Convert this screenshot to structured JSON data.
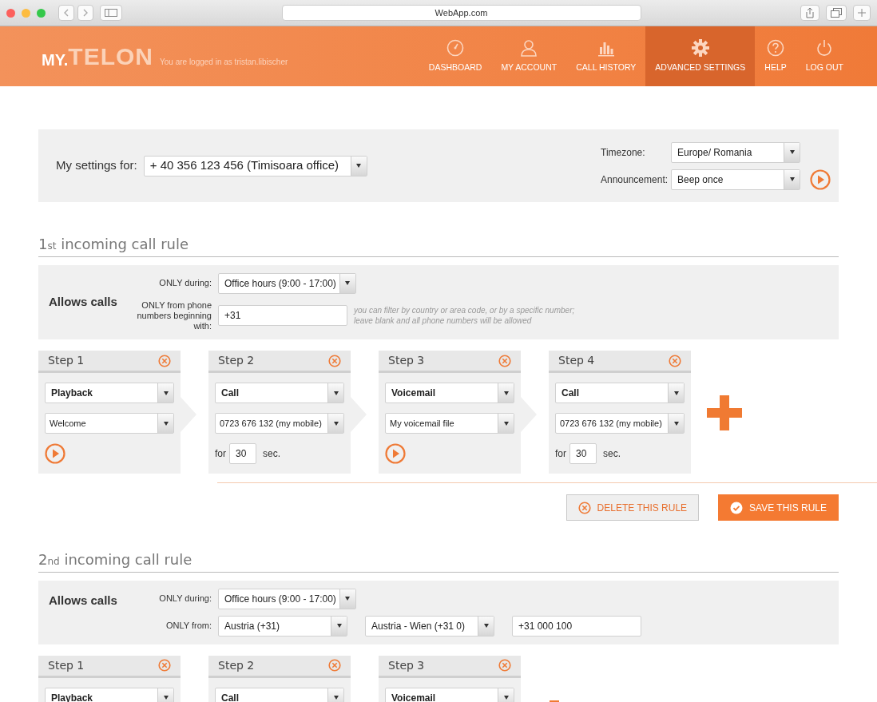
{
  "browser": {
    "url": "WebApp.com"
  },
  "header": {
    "logo_prefix": "MY.",
    "logo_name": "TELON",
    "login_text": "You are logged in as tristan.libischer",
    "nav": [
      {
        "label": "DASHBOARD",
        "selected": false
      },
      {
        "label": "MY ACCOUNT",
        "selected": false
      },
      {
        "label": "CALL HISTORY",
        "selected": false
      },
      {
        "label": "ADVANCED SETTINGS",
        "selected": true
      },
      {
        "label": "HELP",
        "selected": false
      },
      {
        "label": "LOG OUT",
        "selected": false
      }
    ]
  },
  "settings": {
    "label": "My settings for:",
    "number": "+ 40 356 123 456 (Timisoara office)",
    "options": [
      {
        "label": "Timezone:",
        "value": "Europe/ Romania",
        "play": false
      },
      {
        "label": "Announcement:",
        "value": "Beep once",
        "play": true
      }
    ]
  },
  "rules": [
    {
      "title": "1$_{st}$ incoming call rule",
      "allows": "Allows calls",
      "filters": [
        {
          "label": "ONLY during:",
          "controls": [
            {
              "kind": "select",
              "value": "Office hours (9:00 - 17:00)"
            }
          ]
        },
        {
          "label": "ONLY from phone numbers beginning with:",
          "controls": [
            {
              "kind": "input",
              "value": "+31"
            }
          ],
          "hint": "you can filter by country or area code, or by a specific number; leave blank and all phone numbers will be allowed"
        }
      ],
      "steps": [
        {
          "title": "Step 1",
          "type": "Playback",
          "fields": [
            {
              "kind": "select",
              "value": "Welcome"
            },
            {
              "kind": "play"
            }
          ]
        },
        {
          "title": "Step 2",
          "type": "Call",
          "fields": [
            {
              "kind": "select",
              "value": "0723 676 132 (my mobile)"
            },
            {
              "kind": "duration",
              "prefix": "for",
              "value": "30",
              "suffix": "sec."
            }
          ]
        },
        {
          "title": "Step 3",
          "type": "Voicemail",
          "fields": [
            {
              "kind": "select",
              "value": "My voicemail file"
            },
            {
              "kind": "play"
            }
          ]
        },
        {
          "title": "Step 4",
          "type": "Call",
          "fields": [
            {
              "kind": "select",
              "value": "0723 676 132 (my mobile)"
            },
            {
              "kind": "duration",
              "prefix": "for",
              "value": "30",
              "suffix": "sec."
            }
          ]
        }
      ],
      "actions": [
        {
          "kind": "delete",
          "label": "DELETE THIS RULE"
        },
        {
          "kind": "save",
          "label": "SAVE THIS RULE"
        }
      ]
    },
    {
      "title": "2$_{nd}$ incoming call rule",
      "allows": "Allows calls",
      "filters": [
        {
          "label": "ONLY during:",
          "controls": [
            {
              "kind": "select",
              "value": "Office hours (9:00 - 17:00)"
            }
          ]
        },
        {
          "label": "ONLY from:",
          "controls": [
            {
              "kind": "select",
              "value": "Austria (+31)"
            },
            {
              "kind": "select",
              "value": "Austria - Wien (+31 0)"
            },
            {
              "kind": "input",
              "value": "+31 000 100"
            }
          ]
        }
      ],
      "steps": [
        {
          "title": "Step 1",
          "type": "Playback"
        },
        {
          "title": "Step 2",
          "type": "Call"
        },
        {
          "title": "Step 3",
          "type": "Voicemail"
        }
      ]
    }
  ]
}
